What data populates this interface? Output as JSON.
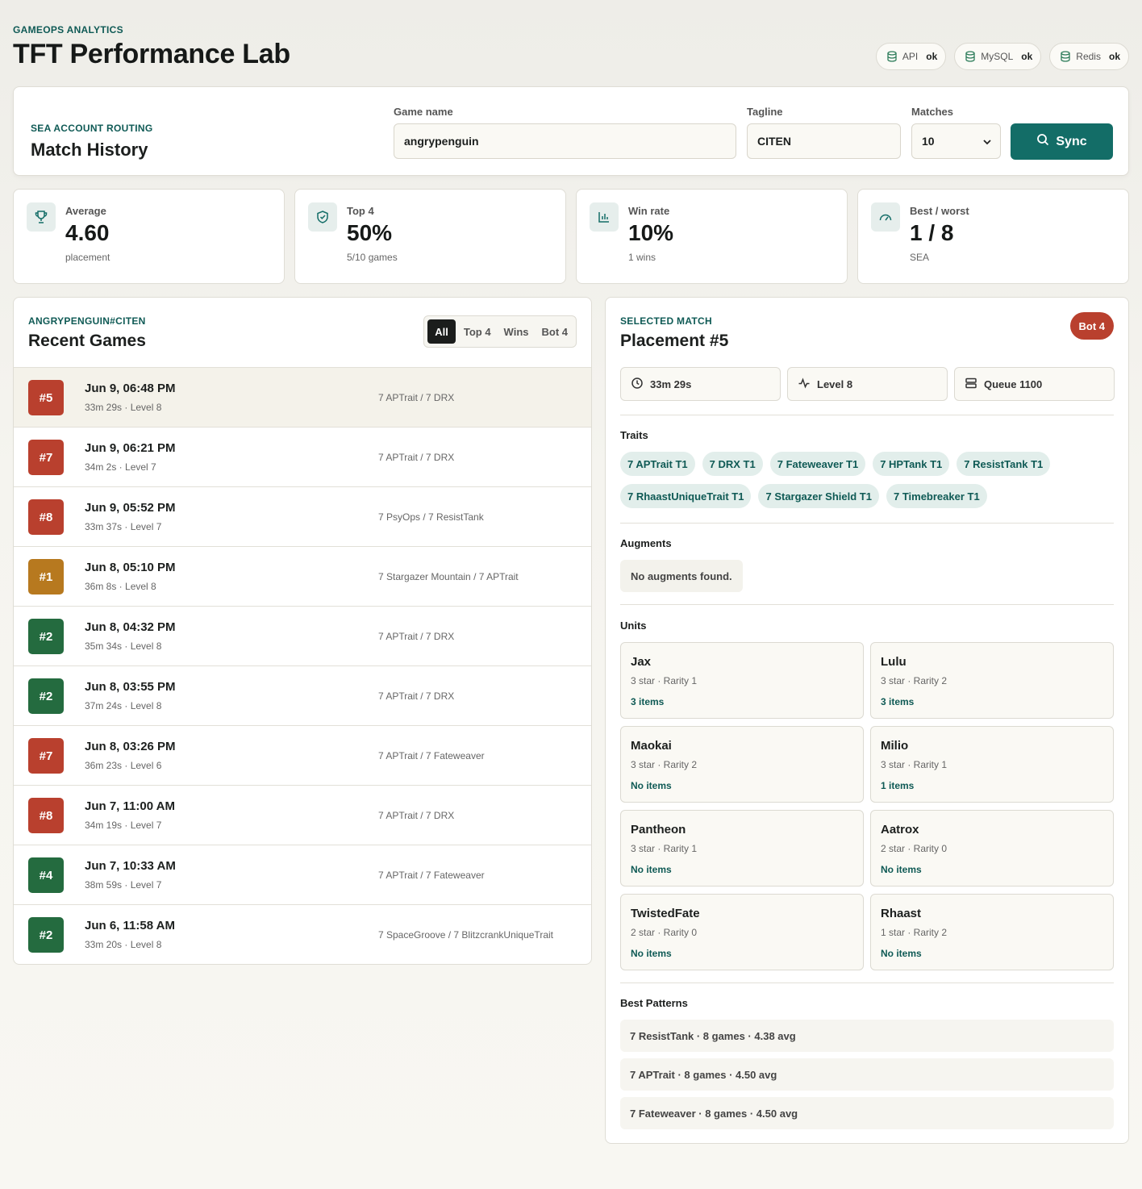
{
  "header": {
    "eyebrow": "GAMEOPS ANALYTICS",
    "title": "TFT Performance Lab",
    "services": [
      {
        "name": "API",
        "status": "ok"
      },
      {
        "name": "MySQL",
        "status": "ok"
      },
      {
        "name": "Redis",
        "status": "ok"
      }
    ]
  },
  "search": {
    "eyebrow": "SEA ACCOUNT ROUTING",
    "title": "Match History",
    "game_name_label": "Game name",
    "game_name_value": "angrypenguin",
    "tagline_label": "Tagline",
    "tagline_value": "CITEN",
    "matches_label": "Matches",
    "matches_value": "10",
    "sync_label": "Sync"
  },
  "stats": [
    {
      "label": "Average",
      "value": "4.60",
      "sub": "placement",
      "icon": "trophy-icon"
    },
    {
      "label": "Top 4",
      "value": "50%",
      "sub": "5/10 games",
      "icon": "shield-check-icon"
    },
    {
      "label": "Win rate",
      "value": "10%",
      "sub": "1 wins",
      "icon": "bar-chart-icon"
    },
    {
      "label": "Best / worst",
      "value": "1 / 8",
      "sub": "SEA",
      "icon": "gauge-icon"
    }
  ],
  "games": {
    "eyebrow": "ANGRYPENGUIN#CITEN",
    "title": "Recent Games",
    "filters": [
      "All",
      "Top 4",
      "Wins",
      "Bot 4"
    ],
    "active_filter": "All",
    "rows": [
      {
        "placement": "#5",
        "time": "Jun 9, 06:48 PM",
        "meta": "33m 29s · Level 8",
        "traits": "7 APTrait / 7 DRX",
        "color": "#b9402e"
      },
      {
        "placement": "#7",
        "time": "Jun 9, 06:21 PM",
        "meta": "34m 2s · Level 7",
        "traits": "7 APTrait / 7 DRX",
        "color": "#b9402e"
      },
      {
        "placement": "#8",
        "time": "Jun 9, 05:52 PM",
        "meta": "33m 37s · Level 7",
        "traits": "7 PsyOps / 7 ResistTank",
        "color": "#b9402e"
      },
      {
        "placement": "#1",
        "time": "Jun 8, 05:10 PM",
        "meta": "36m 8s · Level 8",
        "traits": "7 Stargazer Mountain / 7 APTrait",
        "color": "#b7791f"
      },
      {
        "placement": "#2",
        "time": "Jun 8, 04:32 PM",
        "meta": "35m 34s · Level 8",
        "traits": "7 APTrait / 7 DRX",
        "color": "#246b3f"
      },
      {
        "placement": "#2",
        "time": "Jun 8, 03:55 PM",
        "meta": "37m 24s · Level 8",
        "traits": "7 APTrait / 7 DRX",
        "color": "#246b3f"
      },
      {
        "placement": "#7",
        "time": "Jun 8, 03:26 PM",
        "meta": "36m 23s · Level 6",
        "traits": "7 APTrait / 7 Fateweaver",
        "color": "#b9402e"
      },
      {
        "placement": "#8",
        "time": "Jun 7, 11:00 AM",
        "meta": "34m 19s · Level 7",
        "traits": "7 APTrait / 7 DRX",
        "color": "#b9402e"
      },
      {
        "placement": "#4",
        "time": "Jun 7, 10:33 AM",
        "meta": "38m 59s · Level 7",
        "traits": "7 APTrait / 7 Fateweaver",
        "color": "#246b3f"
      },
      {
        "placement": "#2",
        "time": "Jun 6, 11:58 AM",
        "meta": "33m 20s · Level 8",
        "traits": "7 SpaceGroove / 7 BlitzcrankUniqueTrait",
        "color": "#246b3f"
      }
    ]
  },
  "detail": {
    "eyebrow": "SELECTED MATCH",
    "title": "Placement #5",
    "badge": "Bot 4",
    "duration": "33m 29s",
    "level": "Level 8",
    "queue": "Queue 1100",
    "traits_label": "Traits",
    "traits": [
      "7 APTrait T1",
      "7 DRX T1",
      "7 Fateweaver T1",
      "7 HPTank T1",
      "7 ResistTank T1",
      "7 RhaastUniqueTrait T1",
      "7 Stargazer Shield T1",
      "7 Timebreaker T1"
    ],
    "augments_label": "Augments",
    "augments_empty": "No augments found.",
    "units_label": "Units",
    "units": [
      {
        "name": "Jax",
        "meta": "3 star · Rarity 1",
        "items": "3 items"
      },
      {
        "name": "Lulu",
        "meta": "3 star · Rarity 2",
        "items": "3 items"
      },
      {
        "name": "Maokai",
        "meta": "3 star · Rarity 2",
        "items": "No items"
      },
      {
        "name": "Milio",
        "meta": "3 star · Rarity 1",
        "items": "1 items"
      },
      {
        "name": "Pantheon",
        "meta": "3 star · Rarity 1",
        "items": "No items"
      },
      {
        "name": "Aatrox",
        "meta": "2 star · Rarity 0",
        "items": "No items"
      },
      {
        "name": "TwistedFate",
        "meta": "2 star · Rarity 0",
        "items": "No items"
      },
      {
        "name": "Rhaast",
        "meta": "1 star · Rarity 2",
        "items": "No items"
      }
    ],
    "patterns_label": "Best Patterns",
    "patterns": [
      "7 ResistTank · 8 games · 4.38 avg",
      "7 APTrait · 8 games · 4.50 avg",
      "7 Fateweaver · 8 games · 4.50 avg"
    ]
  }
}
